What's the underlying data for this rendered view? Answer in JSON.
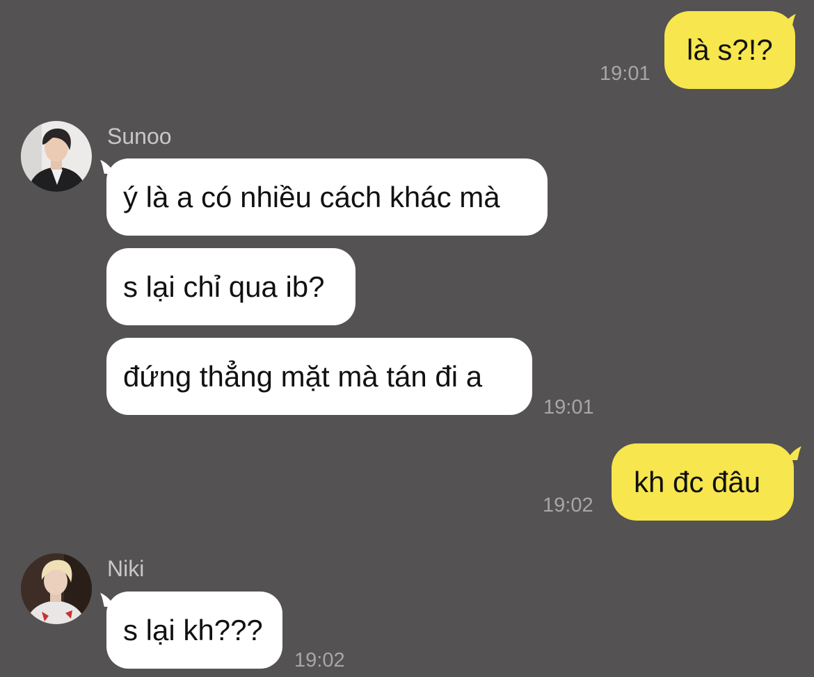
{
  "colors": {
    "background": "#545253",
    "incoming_bubble": "#ffffff",
    "outgoing_bubble": "#f7e64d",
    "timestamp": "#a8a6a7",
    "sender_name": "#c9c7c8"
  },
  "messages": [
    {
      "direction": "outgoing",
      "text": "là s?!?",
      "time": "19:01"
    },
    {
      "direction": "incoming",
      "sender": "Sunoo",
      "avatar_icon": "sunoo-avatar",
      "bubbles": [
        "ý là a có nhiều cách khác mà",
        "s lại chỉ qua ib?",
        "đứng thẳng mặt mà tán đi a"
      ],
      "time": "19:01"
    },
    {
      "direction": "outgoing",
      "text": "kh đc đâu",
      "time": "19:02"
    },
    {
      "direction": "incoming",
      "sender": "Niki",
      "avatar_icon": "niki-avatar",
      "bubbles": [
        "s lại kh???"
      ],
      "time": "19:02"
    }
  ]
}
